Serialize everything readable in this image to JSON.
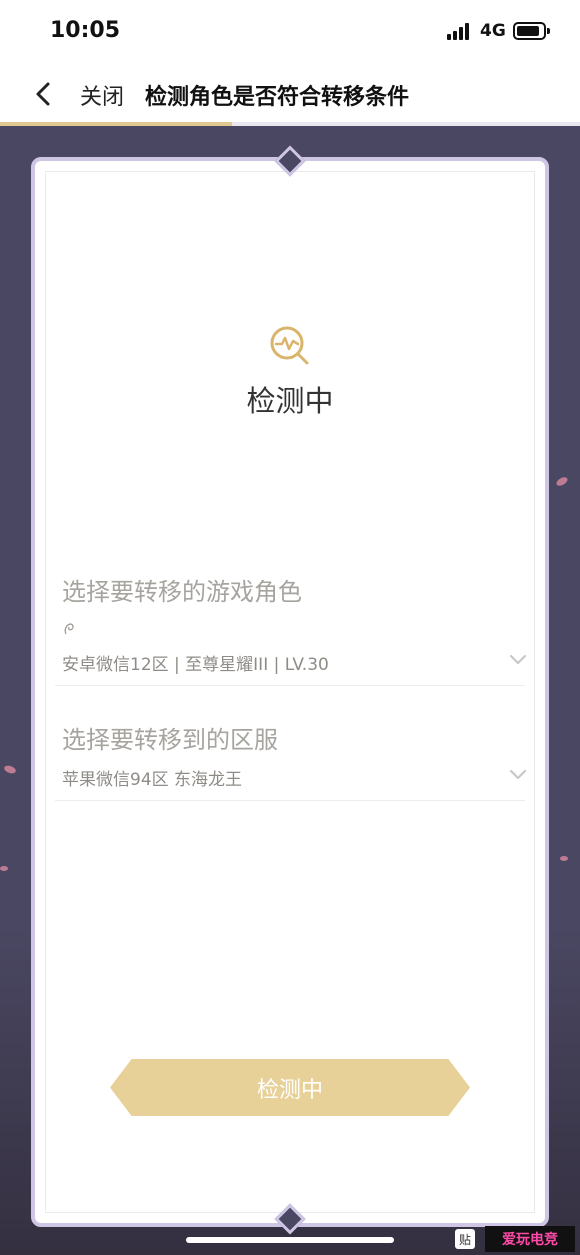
{
  "status_bar": {
    "time": "10:05",
    "network": "4G"
  },
  "nav": {
    "close_label": "关闭",
    "title": "检测角色是否符合转移条件",
    "progress_fraction": 0.4
  },
  "card": {
    "status_title": "检测中",
    "role_section": {
      "label": "选择要转移的游戏角色",
      "value": "安卓微信12区 | 至尊星耀III | LV.30"
    },
    "server_section": {
      "label": "选择要转移到的区服",
      "value": "苹果微信94区 东海龙王"
    },
    "button_label": "检测中"
  },
  "watermark": {
    "stamp": "贴",
    "logo": "爱玩电竞"
  },
  "colors": {
    "accent_gold": "#e0c98f",
    "background_purple": "#4a4762",
    "frame_lavender": "#cfc6e6"
  },
  "icons": {
    "back": "chevron-left-icon",
    "detect": "magnifier-pulse-icon",
    "dropdown": "chevron-down-icon"
  }
}
